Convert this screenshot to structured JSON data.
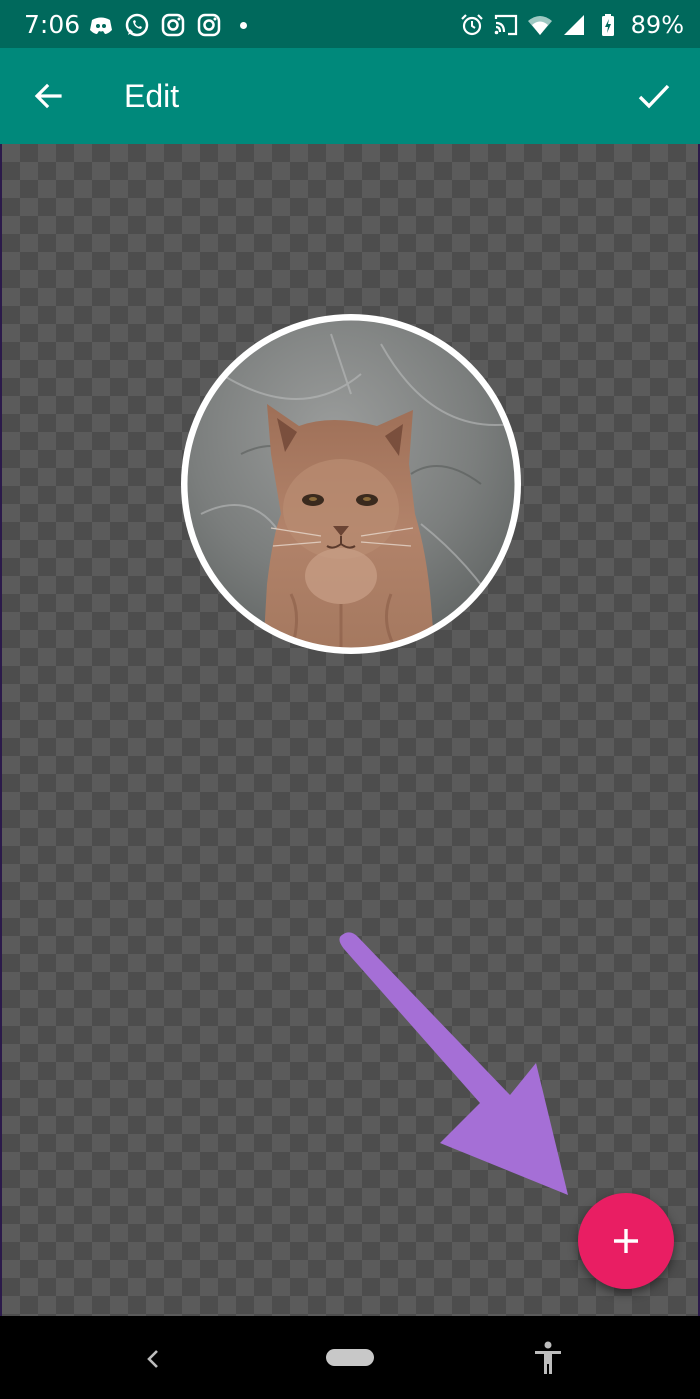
{
  "status_bar": {
    "time": "7:06",
    "left_icons": [
      "discord-icon",
      "whatsapp-icon",
      "instagram-icon",
      "instagram-icon"
    ],
    "right_icons": [
      "alarm-icon",
      "cast-icon",
      "wifi-icon",
      "signal-icon",
      "battery-charging-icon"
    ],
    "battery": "89%"
  },
  "app_bar": {
    "title": "Edit",
    "back_icon": "arrow-back-icon",
    "done_icon": "checkmark-icon"
  },
  "canvas": {
    "sticker": "cat-sticker"
  },
  "fab": {
    "icon": "plus-icon"
  },
  "nav_bar": {
    "icons": [
      "nav-back-icon",
      "nav-home-pill",
      "accessibility-icon"
    ]
  },
  "colors": {
    "status_bar": "#00695c",
    "app_bar": "#00897b",
    "fab": "#e91e63",
    "annotation_arrow": "#a56fd6"
  }
}
